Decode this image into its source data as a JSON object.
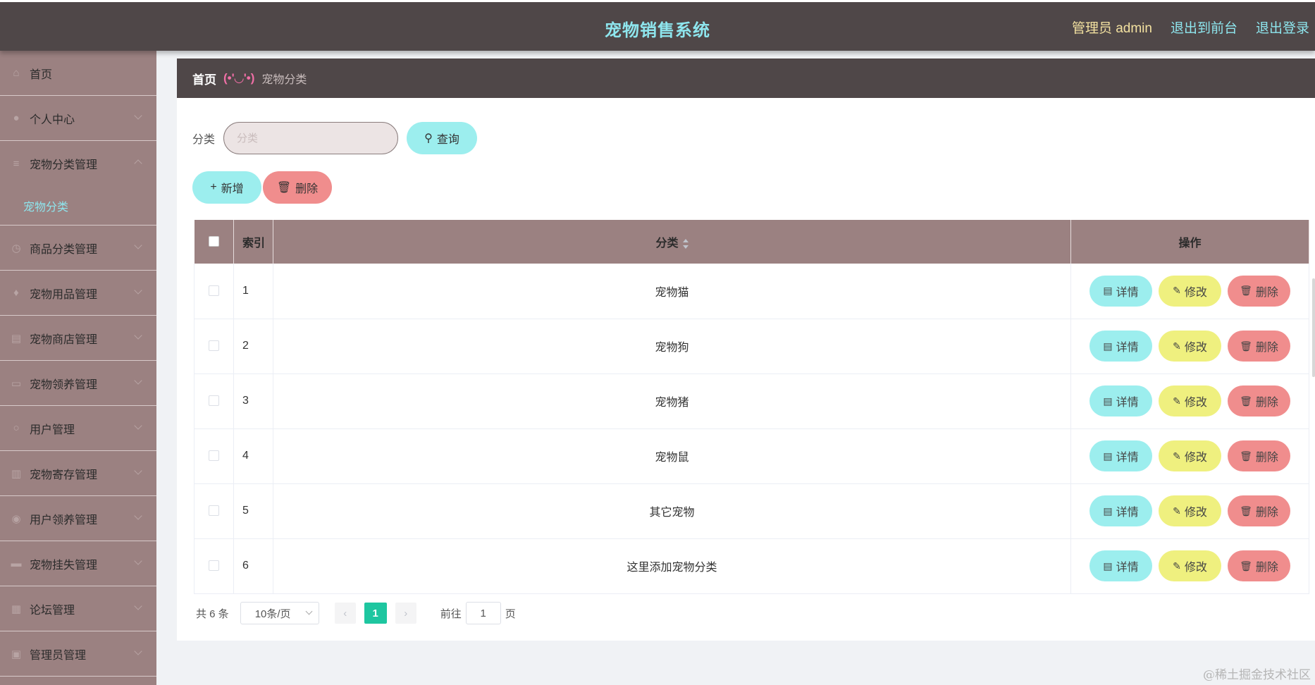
{
  "header": {
    "title": "宠物销售系统",
    "admin": "管理员 admin",
    "to_front": "退出到前台",
    "logout": "退出登录"
  },
  "sidebar": {
    "items": [
      {
        "label": "首页",
        "icon": "home-icon"
      },
      {
        "label": "个人中心",
        "icon": "user-icon"
      },
      {
        "label": "宠物分类管理",
        "icon": "list-icon"
      },
      {
        "label": "商品分类管理",
        "icon": "clock-icon"
      },
      {
        "label": "宠物用品管理",
        "icon": "bulb-icon"
      },
      {
        "label": "宠物商店管理",
        "icon": "doc-icon"
      },
      {
        "label": "宠物领养管理",
        "icon": "monitor-icon"
      },
      {
        "label": "用户管理",
        "icon": "user-outline-icon"
      },
      {
        "label": "宠物寄存管理",
        "icon": "chart-icon"
      },
      {
        "label": "用户领养管理",
        "icon": "location-icon"
      },
      {
        "label": "宠物挂失管理",
        "icon": "folder-icon"
      },
      {
        "label": "论坛管理",
        "icon": "forum-icon"
      },
      {
        "label": "管理员管理",
        "icon": "admin-icon"
      }
    ],
    "sub_active": "宠物分类"
  },
  "breadcrumb": {
    "home": "首页",
    "separator": "(•'◡'•)",
    "current": "宠物分类"
  },
  "search": {
    "label": "分类",
    "placeholder": "分类",
    "query_button": "查询"
  },
  "actions": {
    "add": "新增",
    "delete": "删除"
  },
  "table": {
    "headers": {
      "index": "索引",
      "category": "分类",
      "ops": "操作"
    },
    "rows": [
      {
        "index": "1",
        "category": "宠物猫"
      },
      {
        "index": "2",
        "category": "宠物狗"
      },
      {
        "index": "3",
        "category": "宠物猪"
      },
      {
        "index": "4",
        "category": "宠物鼠"
      },
      {
        "index": "5",
        "category": "其它宠物"
      },
      {
        "index": "6",
        "category": "这里添加宠物分类"
      }
    ],
    "op_labels": {
      "detail": "详情",
      "edit": "修改",
      "delete": "删除"
    }
  },
  "pagination": {
    "total": "共 6 条",
    "page_size": "10条/页",
    "current_page": "1",
    "goto_label": "前往",
    "goto_value": "1",
    "page_suffix": "页"
  },
  "watermark": "@稀土掘金技术社区",
  "colors": {
    "header_bg": "#4f4748",
    "sidebar_bg": "#9b8181",
    "accent_cyan": "#9ceeee",
    "accent_yellow": "#eff07f",
    "accent_red": "#f08d8d",
    "page_active": "#1ec6a0"
  }
}
